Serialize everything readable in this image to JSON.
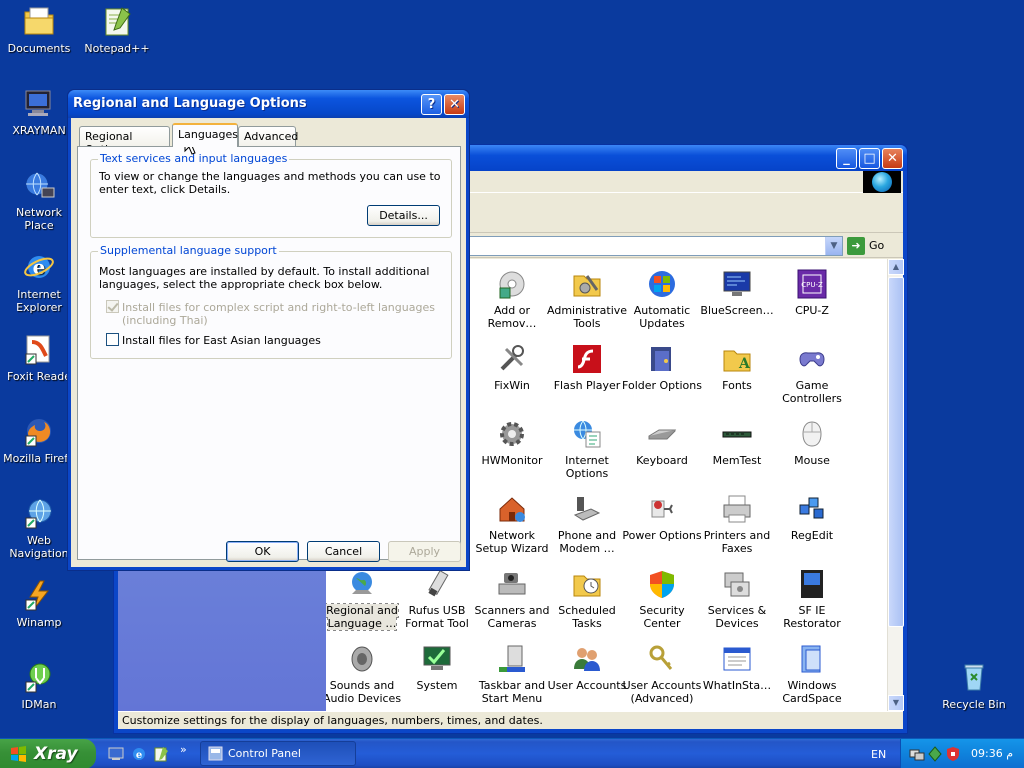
{
  "desktop_icons": [
    {
      "label": "Documents",
      "icon": "documents-icon"
    },
    {
      "label": "Notepad++",
      "icon": "notepad-plus-plus-icon"
    },
    {
      "label": "XRAYMAN",
      "icon": "computer-icon"
    },
    {
      "label": "Network Place",
      "icon": "network-places-icon"
    },
    {
      "label": "Internet Explorer",
      "icon": "internet-explorer-icon"
    },
    {
      "label": "Foxit Reade",
      "icon": "foxit-reader-icon"
    },
    {
      "label": "Mozilla Firefo",
      "icon": "firefox-icon"
    },
    {
      "label": "Web Navigation",
      "icon": "web-navigation-icon"
    },
    {
      "label": "Winamp",
      "icon": "winamp-icon"
    },
    {
      "label": "IDMan",
      "icon": "idman-icon"
    },
    {
      "label": "Recycle Bin",
      "icon": "recycle-bin-icon"
    }
  ],
  "control_panel": {
    "address_go": "Go",
    "status_text": "Customize settings for the display of languages, numbers, times, and dates.",
    "items": [
      {
        "label": "Add or Remov…",
        "icon": "add-remove-programs-icon"
      },
      {
        "label": "Administrative Tools",
        "icon": "administrative-tools-icon"
      },
      {
        "label": "Automatic Updates",
        "icon": "automatic-updates-icon"
      },
      {
        "label": "BlueScreen…",
        "icon": "bluescreen-icon"
      },
      {
        "label": "CPU-Z",
        "icon": "cpu-z-icon"
      },
      {
        "label": "FixWin",
        "icon": "fixwin-icon"
      },
      {
        "label": "Flash Player",
        "icon": "flash-player-icon"
      },
      {
        "label": "Folder Options",
        "icon": "folder-options-icon"
      },
      {
        "label": "Fonts",
        "icon": "fonts-icon"
      },
      {
        "label": "Game Controllers",
        "icon": "game-controllers-icon"
      },
      {
        "label": "HWMonitor",
        "icon": "hwmonitor-icon"
      },
      {
        "label": "Internet Options",
        "icon": "internet-options-icon"
      },
      {
        "label": "Keyboard",
        "icon": "keyboard-icon"
      },
      {
        "label": "MemTest",
        "icon": "memtest-icon"
      },
      {
        "label": "Mouse",
        "icon": "mouse-icon"
      },
      {
        "label": "Network Setup Wizard",
        "icon": "network-setup-icon"
      },
      {
        "label": "Phone and Modem …",
        "icon": "phone-modem-icon"
      },
      {
        "label": "Power Options",
        "icon": "power-options-icon"
      },
      {
        "label": "Printers and Faxes",
        "icon": "printers-icon"
      },
      {
        "label": "RegEdit",
        "icon": "regedit-icon"
      },
      {
        "label": "Regional and Language …",
        "icon": "regional-language-icon"
      },
      {
        "label": "Rufus USB Format Tool",
        "icon": "rufus-icon"
      },
      {
        "label": "Scanners and Cameras",
        "icon": "scanners-icon"
      },
      {
        "label": "Scheduled Tasks",
        "icon": "scheduled-tasks-icon"
      },
      {
        "label": "Security Center",
        "icon": "security-center-icon"
      },
      {
        "label": "Services & Devices",
        "icon": "services-icon"
      },
      {
        "label": "SF IE Restorator",
        "icon": "sf-ie-restorator-icon"
      },
      {
        "label": "Sounds and Audio Devices",
        "icon": "sounds-icon"
      },
      {
        "label": "System",
        "icon": "system-icon"
      },
      {
        "label": "Taskbar and Start Menu",
        "icon": "taskbar-icon"
      },
      {
        "label": "User Accounts",
        "icon": "user-accounts-icon"
      },
      {
        "label": "User Accounts (Advanced)",
        "icon": "user-accounts-advanced-icon"
      },
      {
        "label": "WhatInSta…",
        "icon": "whatinstartup-icon"
      },
      {
        "label": "Windows CardSpace",
        "icon": "cardspace-icon"
      }
    ]
  },
  "dialog": {
    "title": "Regional and Language Options",
    "help_btn": "?",
    "close_btn": "✕",
    "tabs": [
      "Regional Options",
      "Languages",
      "Advanced"
    ],
    "active_tab": "Languages",
    "group1": {
      "title": "Text services and input languages",
      "text": "To view or change the languages and methods you can use to enter text, click Details.",
      "button": "Details..."
    },
    "group2": {
      "title": "Supplemental language support",
      "text": "Most languages are installed by default. To install additional languages, select the appropriate check box below.",
      "check1": {
        "label": "Install files for complex script and right-to-left languages (including Thai)",
        "checked": true,
        "disabled": true
      },
      "check2": {
        "label": "Install files for East Asian languages",
        "checked": false,
        "disabled": false
      }
    },
    "ok": "OK",
    "cancel": "Cancel",
    "apply": "Apply"
  },
  "taskbar": {
    "start_label": "Xray",
    "task_label": "Control Panel",
    "language": "EN",
    "clock": "09:36 م",
    "chevron": "»"
  },
  "colors": {
    "desktop": "#0a3a9e",
    "xp_blue": "#0b46c8",
    "start_green": "#379037",
    "group_title": "#0046d5"
  }
}
